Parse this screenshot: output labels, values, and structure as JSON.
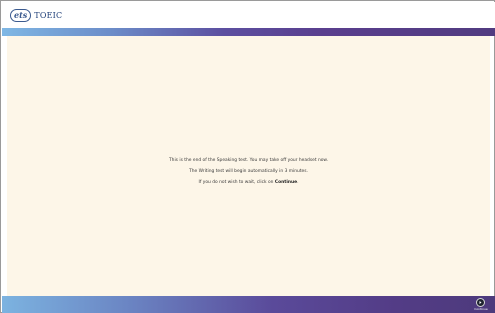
{
  "header": {
    "logo_ets": "ets",
    "logo_product": "TOEIC",
    "logo_icon": "ets-toeic-logo"
  },
  "message": {
    "line1": "This is the end of the Speaking test. You may take off your headset now.",
    "line2": "The Writing test will begin automatically in 3 minutes.",
    "line3_prefix": "If you do not wish to wait, click on ",
    "line3_action": "Continue",
    "line3_suffix": "."
  },
  "footer": {
    "continue_label": "Continue",
    "continue_icon": "arrow-right-circle-icon"
  },
  "colors": {
    "content_bg": "#fdf6e8",
    "band_left": "#7fb7e4",
    "band_right": "#513b80"
  }
}
